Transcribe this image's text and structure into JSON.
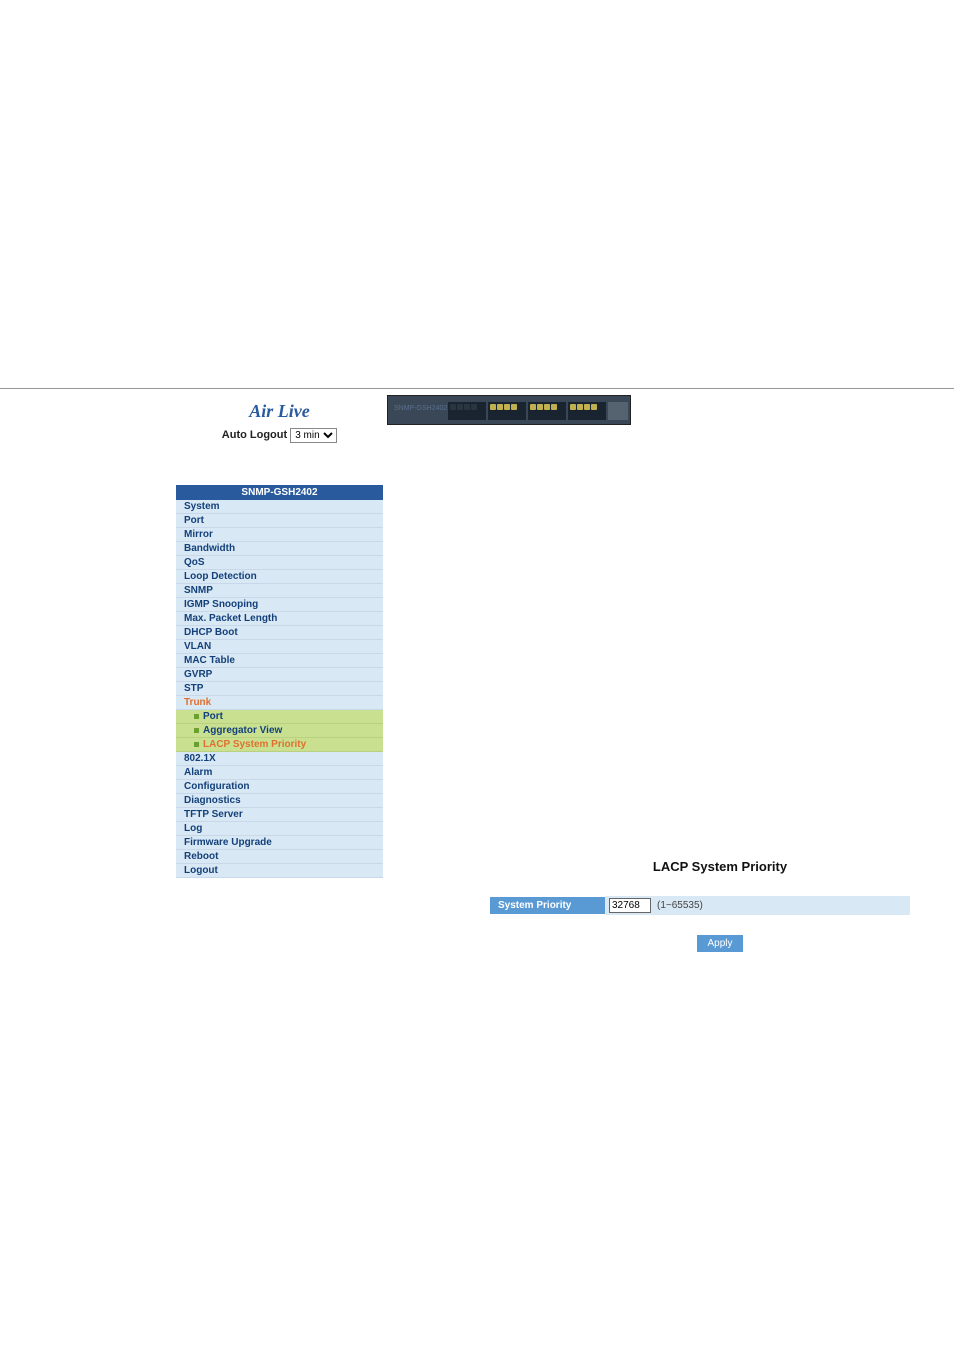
{
  "brand": "Air Live",
  "autoLogout": {
    "label": "Auto Logout",
    "value": "3 min"
  },
  "device": {
    "model": "SNMP-GSH2402"
  },
  "menu": {
    "header": "SNMP-GSH2402",
    "items": [
      {
        "label": "System"
      },
      {
        "label": "Port"
      },
      {
        "label": "Mirror"
      },
      {
        "label": "Bandwidth"
      },
      {
        "label": "QoS"
      },
      {
        "label": "Loop Detection"
      },
      {
        "label": "SNMP"
      },
      {
        "label": "IGMP Snooping"
      },
      {
        "label": "Max. Packet Length"
      },
      {
        "label": "DHCP Boot"
      },
      {
        "label": "VLAN"
      },
      {
        "label": "MAC Table"
      },
      {
        "label": "GVRP"
      },
      {
        "label": "STP"
      }
    ],
    "trunk": {
      "label": "Trunk",
      "sub": [
        {
          "label": "Port"
        },
        {
          "label": "Aggregator View"
        },
        {
          "label": "LACP System Priority"
        }
      ]
    },
    "items2": [
      {
        "label": "802.1X"
      },
      {
        "label": "Alarm"
      },
      {
        "label": "Configuration"
      },
      {
        "label": "Diagnostics"
      },
      {
        "label": "TFTP Server"
      },
      {
        "label": "Log"
      },
      {
        "label": "Firmware Upgrade"
      },
      {
        "label": "Reboot"
      },
      {
        "label": "Logout"
      }
    ]
  },
  "page": {
    "title": "LACP System Priority",
    "fieldLabel": "System Priority",
    "fieldValue": "32768",
    "range": "(1~65535)",
    "applyLabel": "Apply"
  }
}
